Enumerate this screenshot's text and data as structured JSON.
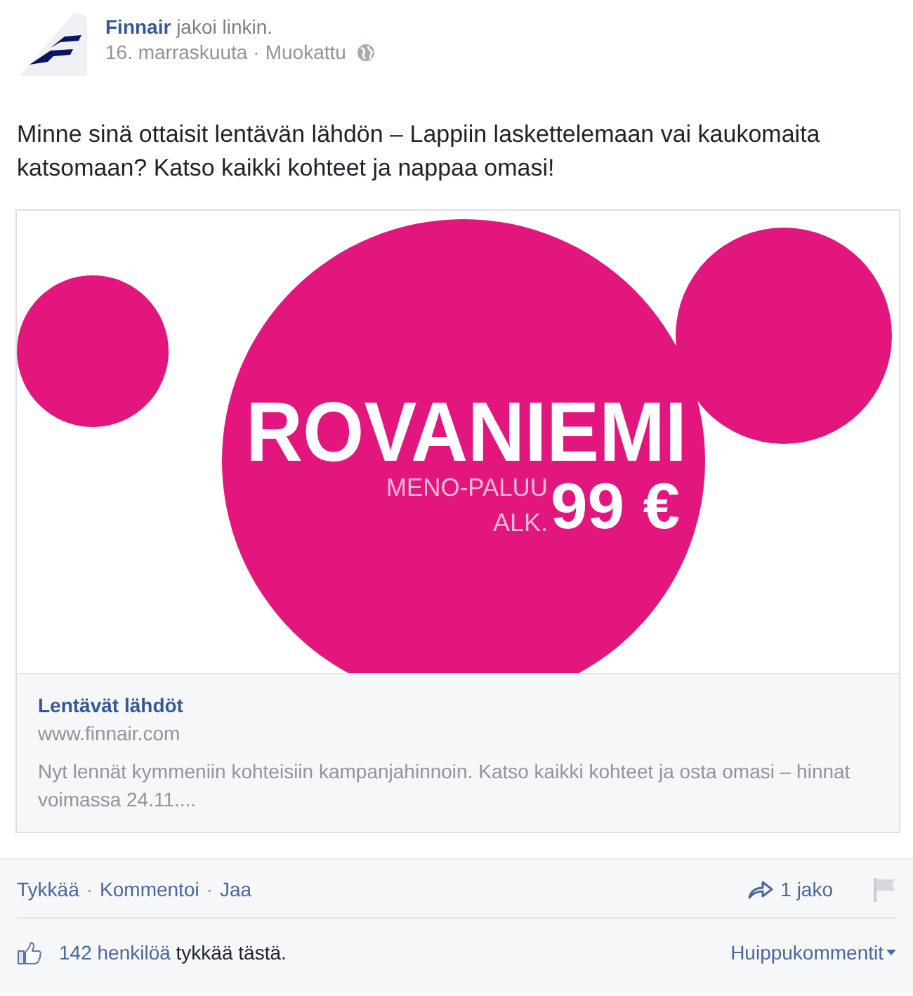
{
  "post": {
    "author": "Finnair",
    "action": "jakoi linkin.",
    "date": "16. marraskuuta",
    "separator": "·",
    "edited": "Muokattu",
    "text": "Minne sinä ottaisit lentävän lähdön – Lappiin laskettelemaan vai kaukomaita katsomaan? Katso kaikki kohteet ja nappaa omasi!"
  },
  "link": {
    "banner": {
      "headline": "ROVANIEMI",
      "line_1": "MENO-PALUU",
      "line_2": "ALK.",
      "price": "99 €"
    },
    "title": "Lentävät lähdöt",
    "domain": "www.finnair.com",
    "description": "Nyt lennät kymmeniin kohteisiin kampanjahinnoin. Katso kaikki kohteet ja osta omasi – hinnat voimassa 24.11...."
  },
  "actions": [
    {
      "kind": "link",
      "label": "Tykkää"
    },
    {
      "kind": "dot",
      "label": "·"
    },
    {
      "kind": "link",
      "label": "Kommentoi"
    },
    {
      "kind": "dot",
      "label": "·"
    },
    {
      "kind": "link",
      "label": "Jaa"
    }
  ],
  "shares": "1 jako",
  "likes": {
    "count": "142 henkilöä",
    "rest": "tykkää tästä."
  },
  "sort": "Huippukommentit"
}
